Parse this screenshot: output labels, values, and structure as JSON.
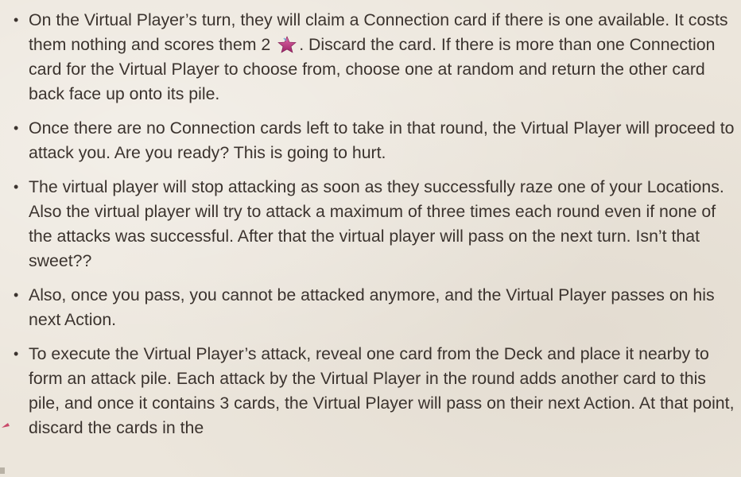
{
  "rules": {
    "b1_a": "On the Virtual Player’s turn, they will claim a Connection card if there is one available. It costs them nothing and scores them 2",
    "b1_icon": "star-icon",
    "b1_b": ". Discard the card. If there is more than one Connection card for the Virtual Player to choose from, choose one at random and return the other card back face up onto its pile.",
    "b2": "Once there are no Connection cards left to take in that round, the Virtual Player will proceed to attack you. Are you ready? This is going to hurt.",
    "b3": "The virtual player will stop attacking as soon as they successfully raze one of your Locations. Also the virtual player will try to attack a maximum of three times each round even if none of the attacks was successful. After that the virtual player will pass on the next turn. Isn’t that sweet??",
    "b4": "Also, once you pass, you cannot be attacked anymore, and the Virtual Player passes on his next Action.",
    "b5": "To execute the Virtual Player’s attack, reveal one card from the Deck and place it nearby to form an attack pile. Each attack by the Virtual Player in the round adds another card to this pile, and once it contains 3 cards, the Virtual Player will pass on their next Action.  At that point, discard the cards in the"
  },
  "colors": {
    "text": "#3b332e",
    "star": "#b5307a",
    "background": "#ece6dc"
  }
}
